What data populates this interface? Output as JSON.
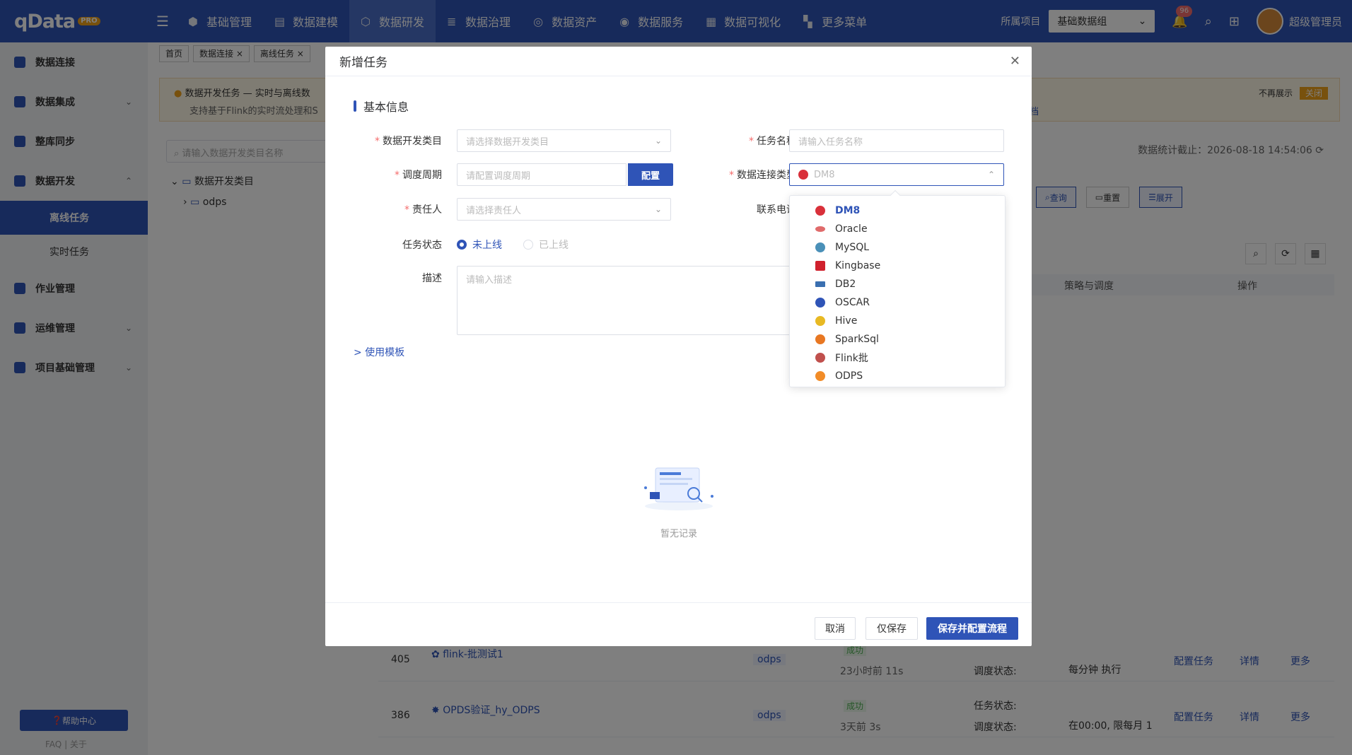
{
  "app": {
    "logo": "qData",
    "logo_badge": "PRO"
  },
  "topnav": [
    {
      "label": "基础管理"
    },
    {
      "label": "数据建模"
    },
    {
      "label": "数据研发"
    },
    {
      "label": "数据治理"
    },
    {
      "label": "数据资产"
    },
    {
      "label": "数据服务"
    },
    {
      "label": "数据可视化"
    },
    {
      "label": "更多菜单"
    }
  ],
  "header": {
    "project_label": "所属项目",
    "project_value": "基础数据组",
    "notification_count": "96",
    "user_name": "超级管理员"
  },
  "sidebar": {
    "items": [
      {
        "label": "数据连接"
      },
      {
        "label": "数据集成"
      },
      {
        "label": "整库同步"
      },
      {
        "label": "数据开发"
      },
      {
        "label": "作业管理"
      },
      {
        "label": "运维管理"
      },
      {
        "label": "项目基础管理"
      }
    ],
    "subitems": [
      {
        "label": "离线任务"
      },
      {
        "label": "实时任务"
      }
    ],
    "help": "帮助中心",
    "faq": "FAQ",
    "about": "关于"
  },
  "tabs": [
    {
      "label": "首页"
    },
    {
      "label": "数据连接"
    },
    {
      "label": "离线任务"
    }
  ],
  "notice": {
    "title": "数据开发任务 — 实时与离线数",
    "sub": "支持基于Flink的实时流处理和S",
    "dismiss": "不再展示",
    "close": "关闭",
    "doc": "档"
  },
  "tree": {
    "search_placeholder": "请输入数据开发类目名称",
    "root": "数据开发类目",
    "child": "odps"
  },
  "stats": {
    "text": "数据统计截止：2026-08-18 14:54:06"
  },
  "toolbar": {
    "query": "查询",
    "reset": "重置",
    "expand": "展开"
  },
  "table": {
    "headers": {
      "schedule": "策略与调度",
      "ops": "操作"
    },
    "run_tag": "执行",
    "every_minute": "每分钟 执行",
    "task_state_label": "任务状态:",
    "sched_state_label": "调度状态:",
    "ops": {
      "config": "配置任务",
      "detail": "详情",
      "more": "更多"
    },
    "rows": [
      {
        "id": "405",
        "name": "flink-批测试1",
        "type": "odps",
        "status": "成功",
        "time": "23小时前",
        "duration": "11s",
        "schedule": "每分钟 执行"
      },
      {
        "id": "386",
        "name": "OPDS验证_hy_ODPS",
        "type": "odps",
        "status": "成功",
        "time": "3天前",
        "duration": "3s",
        "schedule": "在00:00, 限每月 1"
      }
    ]
  },
  "modal": {
    "title": "新增任务",
    "section": "基本信息",
    "fields": {
      "category": {
        "label": "数据开发类目",
        "placeholder": "请选择数据开发类目"
      },
      "task_name": {
        "label": "任务名称",
        "placeholder": "请输入任务名称"
      },
      "schedule": {
        "label": "调度周期",
        "placeholder": "请配置调度周期",
        "button": "配置"
      },
      "conn_type": {
        "label": "数据连接类型",
        "value": "DM8"
      },
      "owner": {
        "label": "责任人",
        "placeholder": "请选择责任人"
      },
      "phone": {
        "label": "联系电话"
      },
      "status": {
        "label": "任务状态",
        "opt_offline": "未上线",
        "opt_online": "已上线"
      },
      "desc": {
        "label": "描述",
        "placeholder": "请输入描述"
      }
    },
    "use_template": "> 使用模板",
    "empty": "暂无记录",
    "footer": {
      "cancel": "取消",
      "save_only": "仅保存",
      "save_config": "保存并配置流程"
    }
  },
  "dropdown": {
    "options": [
      {
        "label": "DM8",
        "color": "#d9303a"
      },
      {
        "label": "Oracle",
        "color": "#e06b6b"
      },
      {
        "label": "MySQL",
        "color": "#4a90b8"
      },
      {
        "label": "Kingbase",
        "color": "#d0212d"
      },
      {
        "label": "DB2",
        "color": "#3a6fb0"
      },
      {
        "label": "OSCAR",
        "color": "#2f54b7"
      },
      {
        "label": "Hive",
        "color": "#e8b923"
      },
      {
        "label": "SparkSql",
        "color": "#e87722"
      },
      {
        "label": "Flink批",
        "color": "#c0504d"
      },
      {
        "label": "ODPS",
        "color": "#f28c28"
      }
    ]
  }
}
